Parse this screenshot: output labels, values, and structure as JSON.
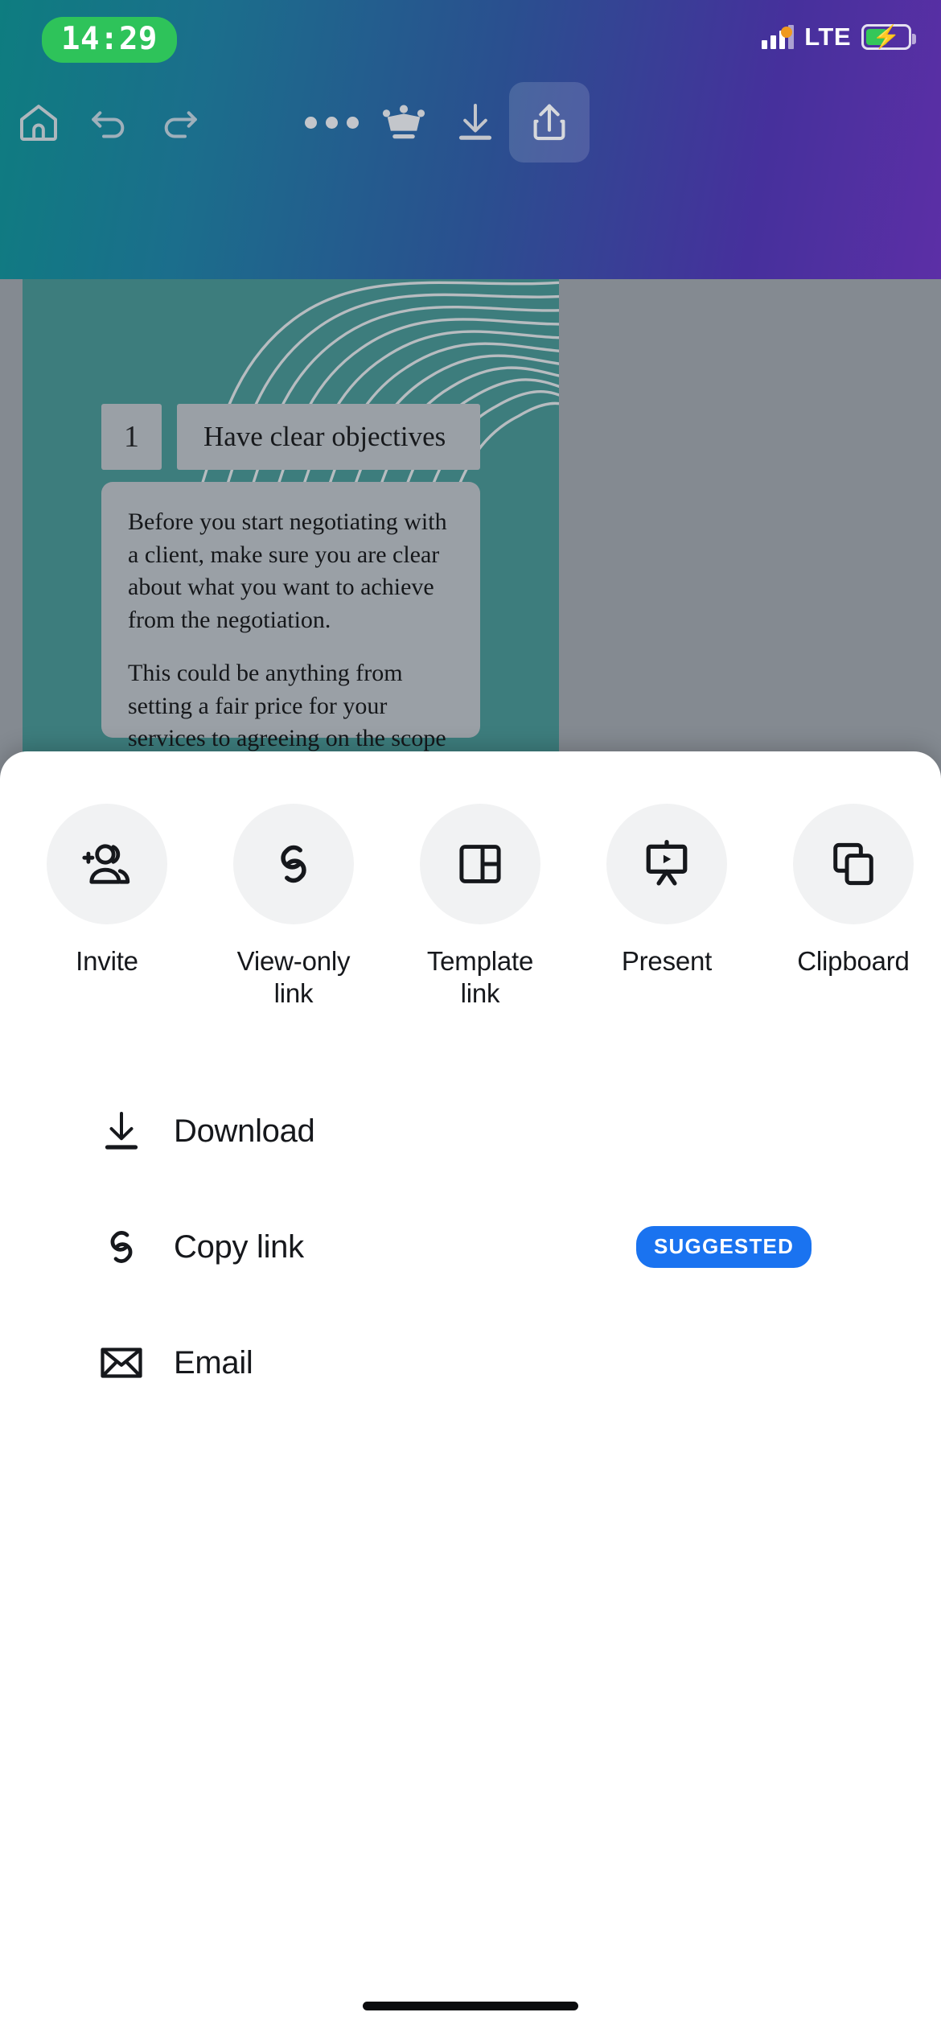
{
  "status_bar": {
    "time": "14:29",
    "network_label": "LTE",
    "orange_dot_icon": "recording-indicator-dot",
    "signal_icon": "signal-bars-icon",
    "battery_icon": "battery-charging-icon"
  },
  "toolbar": {
    "items": [
      {
        "name": "home-button",
        "icon": "home-icon",
        "label": "Home"
      },
      {
        "name": "undo-button",
        "icon": "undo-icon",
        "label": "Undo"
      },
      {
        "name": "redo-button",
        "icon": "redo-icon",
        "label": "Redo"
      },
      {
        "name": "more-button",
        "icon": "three-dots-icon",
        "label": "More"
      },
      {
        "name": "upgrade-button",
        "icon": "crown-icon",
        "label": "Upgrade"
      },
      {
        "name": "download-button",
        "icon": "download-icon",
        "label": "Download"
      },
      {
        "name": "share-button",
        "icon": "share-upload-icon",
        "label": "Share"
      }
    ]
  },
  "slide": {
    "number": "1",
    "title": "Have clear objectives",
    "paragraphs": [
      "Before you start negotiating with a client, make sure you are clear about what you want to achieve from the negotiation.",
      "This could be anything from setting a fair price for your services to agreeing on the scope of the project."
    ]
  },
  "share_sheet": {
    "quick_actions": [
      {
        "label": "Invite",
        "icon": "add-person-icon"
      },
      {
        "label": "View-only\nlink",
        "icon": "link-chain-icon"
      },
      {
        "label": "Template\nlink",
        "icon": "template-panel-icon"
      },
      {
        "label": "Present",
        "icon": "presentation-play-icon"
      },
      {
        "label": "Clipboard",
        "icon": "copy-icon"
      }
    ],
    "list_items": [
      {
        "label": "Download",
        "icon": "download-icon",
        "badge": ""
      },
      {
        "label": "Copy link",
        "icon": "link-chain-icon",
        "badge": "SUGGESTED"
      },
      {
        "label": "Email",
        "icon": "envelope-icon",
        "badge": ""
      }
    ]
  },
  "colors": {
    "accent_blue": "#1a73f0",
    "slide_teal": "#3d7d7d",
    "scrim_gray": "#848a91",
    "time_pill_green": "#2ec35a"
  }
}
